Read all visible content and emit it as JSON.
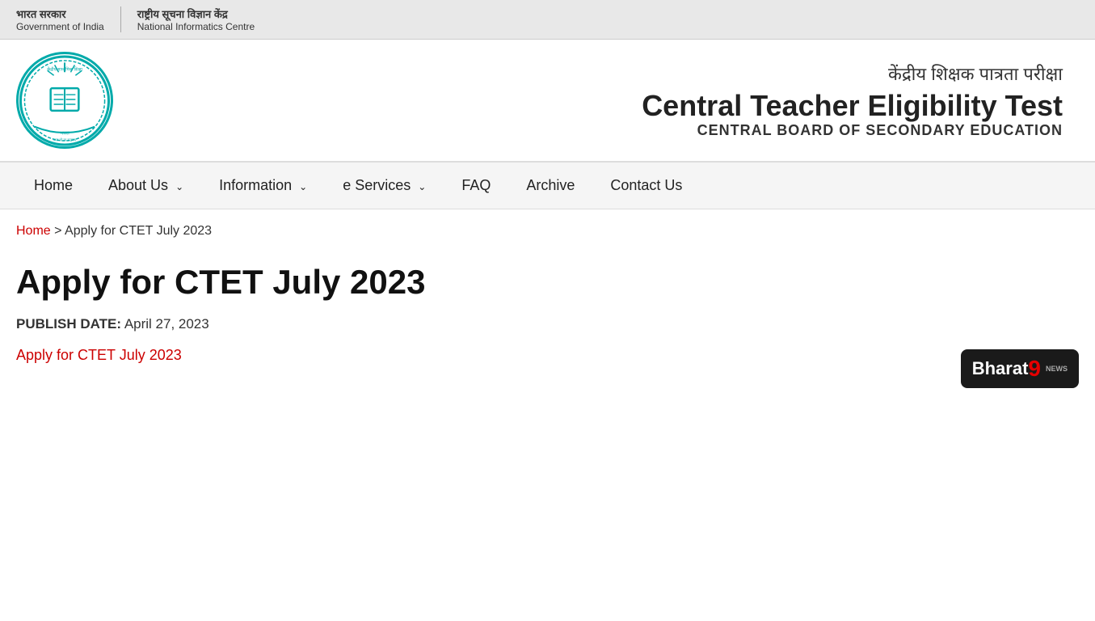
{
  "topbar": {
    "left_hindi": "भारत सरकार",
    "left_english": "Government of India",
    "right_hindi": "राष्ट्रीय सूचना विज्ञान केंद्र",
    "right_english": "National Informatics Centre"
  },
  "header": {
    "title_hindi": "केंद्रीय शिक्षक पात्रता परीक्षा",
    "title_english": "Central Teacher Eligibility Test",
    "subtitle": "CENTRAL BOARD OF SECONDARY EDUCATION"
  },
  "navbar": {
    "items": [
      {
        "label": "Home",
        "has_chevron": false
      },
      {
        "label": "About Us",
        "has_chevron": true
      },
      {
        "label": "Information",
        "has_chevron": true
      },
      {
        "label": "e Services",
        "has_chevron": true
      },
      {
        "label": "FAQ",
        "has_chevron": false
      },
      {
        "label": "Archive",
        "has_chevron": false
      },
      {
        "label": "Contact Us",
        "has_chevron": false
      }
    ]
  },
  "breadcrumb": {
    "home": "Home",
    "separator": " > ",
    "current": "Apply for CTET July 2023"
  },
  "page": {
    "title": "Apply for CTET July 2023",
    "publish_label": "PUBLISH DATE:",
    "publish_date": "April 27, 2023",
    "link_text": "Apply for CTET July 2023"
  },
  "bharat9": {
    "bharat": "Bharat",
    "nine": "9",
    "news": "NEWS"
  }
}
